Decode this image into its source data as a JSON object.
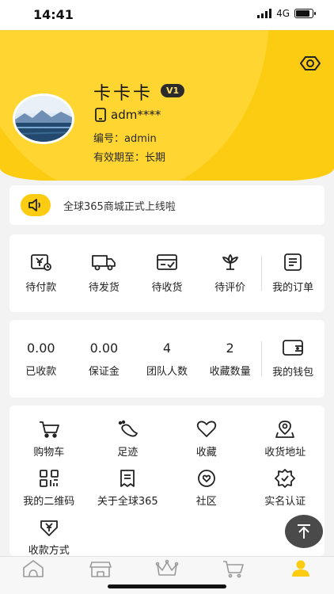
{
  "status": {
    "time": "14:41",
    "network": "4G",
    "battery_level": 0.85
  },
  "profile": {
    "name": "卡卡卡",
    "level_badge": "V1",
    "account": "adm****",
    "id_line": "编号：admin",
    "validity_line": "有效期至：长期"
  },
  "notice": {
    "text": "全球365商城正式上线啦"
  },
  "orders": [
    {
      "label": "待付款",
      "icon": "wallet-yen-icon"
    },
    {
      "label": "待发货",
      "icon": "truck-icon"
    },
    {
      "label": "待收货",
      "icon": "card-check-icon"
    },
    {
      "label": "待评价",
      "icon": "flower-icon"
    },
    {
      "label": "我的订单",
      "icon": "order-list-icon"
    }
  ],
  "wallet": {
    "stats": [
      {
        "value": "0.00",
        "label": "已收款"
      },
      {
        "value": "0.00",
        "label": "保证金"
      },
      {
        "value": "4",
        "label": "团队人数"
      },
      {
        "value": "2",
        "label": "收藏数量"
      }
    ],
    "my_wallet_label": "我的钱包"
  },
  "tools": [
    {
      "label": "购物车",
      "icon": "cart-icon"
    },
    {
      "label": "足迹",
      "icon": "footprint-icon"
    },
    {
      "label": "收藏",
      "icon": "heart-icon"
    },
    {
      "label": "收货地址",
      "icon": "location-icon"
    },
    {
      "label": "我的二维码",
      "icon": "qrcode-icon"
    },
    {
      "label": "关于全球365",
      "icon": "document-icon"
    },
    {
      "label": "社区",
      "icon": "community-icon"
    },
    {
      "label": "实名认证",
      "icon": "verified-badge-icon"
    },
    {
      "label": "收款方式",
      "icon": "yen-shield-icon"
    }
  ],
  "tabbar": [
    {
      "name": "home",
      "icon": "home-icon",
      "active": false
    },
    {
      "name": "store",
      "icon": "store-icon",
      "active": false
    },
    {
      "name": "vip",
      "icon": "crown-icon",
      "active": false
    },
    {
      "name": "cart",
      "icon": "cart-icon",
      "active": false
    },
    {
      "name": "mine",
      "icon": "user-icon",
      "active": true
    }
  ],
  "colors": {
    "brand_yellow": "#fccc12",
    "tab_inactive": "#999999",
    "dark": "#222222"
  }
}
